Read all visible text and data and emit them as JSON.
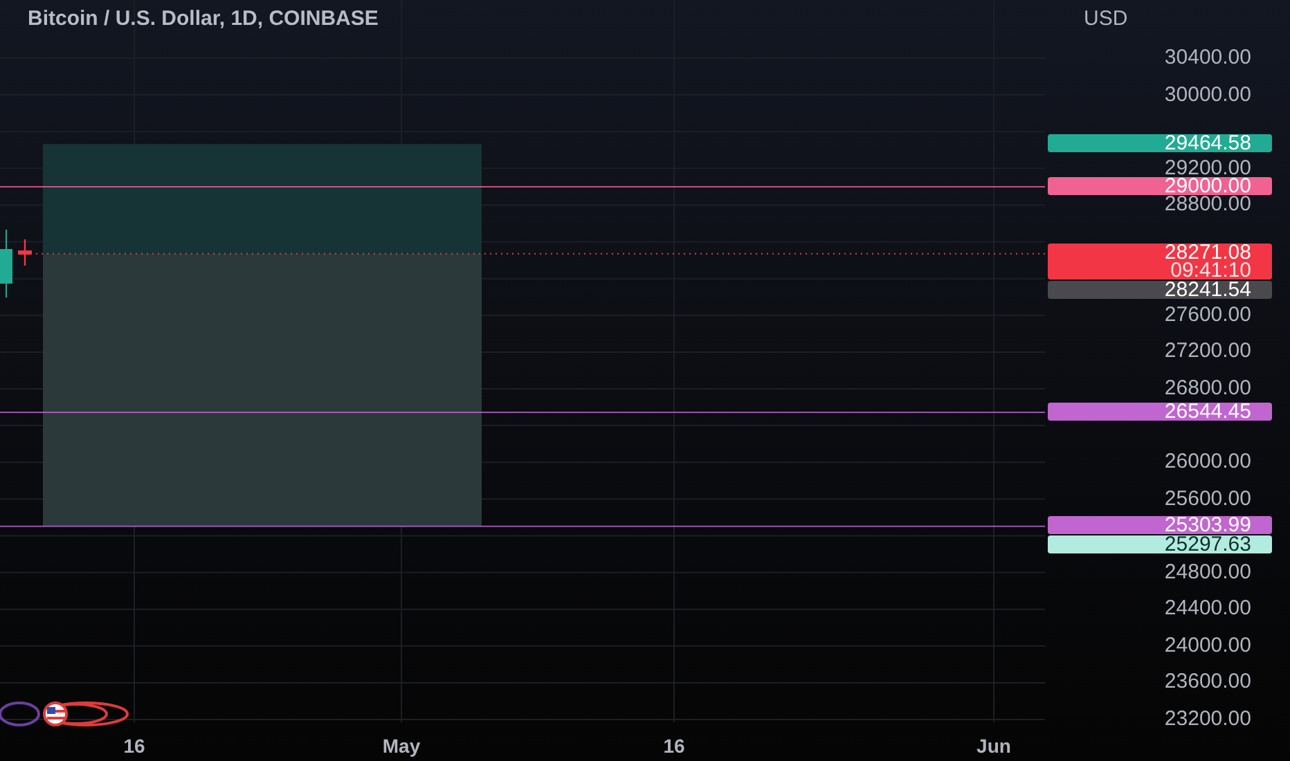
{
  "title": "Bitcoin / U.S. Dollar, 1D, COINBASE",
  "price_axis": {
    "currency": "USD",
    "ticks": [
      "30400.00",
      "30000.00",
      "29200.00",
      "28800.00",
      "27600.00",
      "27200.00",
      "26800.00",
      "26000.00",
      "25600.00",
      "24800.00",
      "24400.00",
      "24000.00",
      "23600.00",
      "23200.00"
    ]
  },
  "price_labels": [
    {
      "kind": "target",
      "value": "29464.58",
      "color": "#22ab94"
    },
    {
      "kind": "line",
      "value": "29000.00",
      "color": "#f06292"
    },
    {
      "kind": "last",
      "value": "28271.08",
      "countdown": "09:41:10",
      "color": "#f23645"
    },
    {
      "kind": "prev",
      "value": "28241.54",
      "color": "#4a4a4e"
    },
    {
      "kind": "line",
      "value": "26544.45",
      "color": "#c165d0"
    },
    {
      "kind": "stop",
      "value": "25303.99",
      "color": "#c165d0"
    },
    {
      "kind": "low",
      "value": "25297.63",
      "color": "#b2ebe0"
    }
  ],
  "time_axis": [
    "16",
    "May",
    "16",
    "Jun"
  ]
}
